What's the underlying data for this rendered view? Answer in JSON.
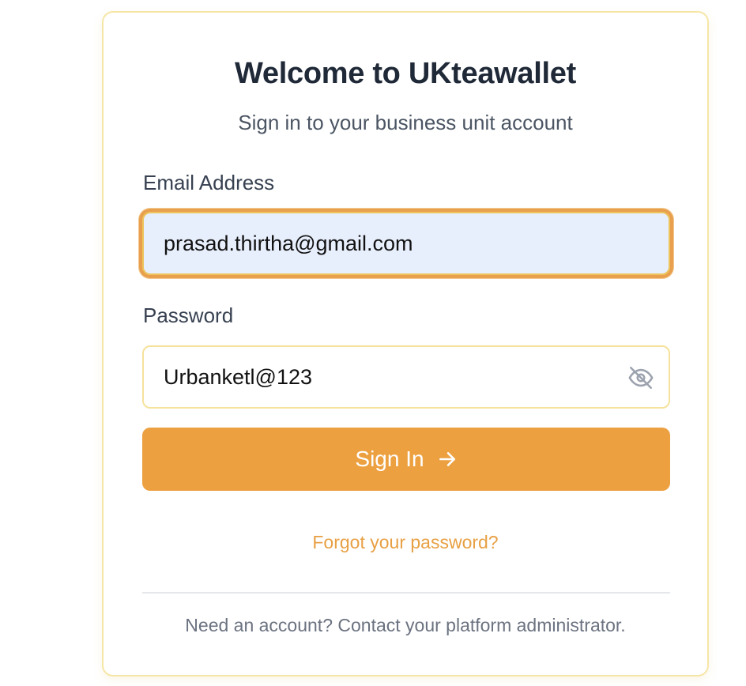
{
  "header": {
    "title": "Welcome to UKteawallet",
    "subtitle": "Sign in to your business unit account"
  },
  "form": {
    "email_label": "Email Address",
    "email_value": "prasad.thirtha@gmail.com",
    "password_label": "Password",
    "password_value": "Urbanketl@123",
    "password_toggle_icon": "eye-off-icon",
    "signin_label": "Sign In",
    "signin_icon": "arrow-right-icon",
    "forgot_link": "Forgot your password?"
  },
  "footer": {
    "text": "Need an account? Contact your platform administrator."
  },
  "colors": {
    "accent": "#eca040",
    "card_border": "#f6e6a6",
    "autofill_bg": "#e8effc",
    "link": "#e8a044"
  }
}
